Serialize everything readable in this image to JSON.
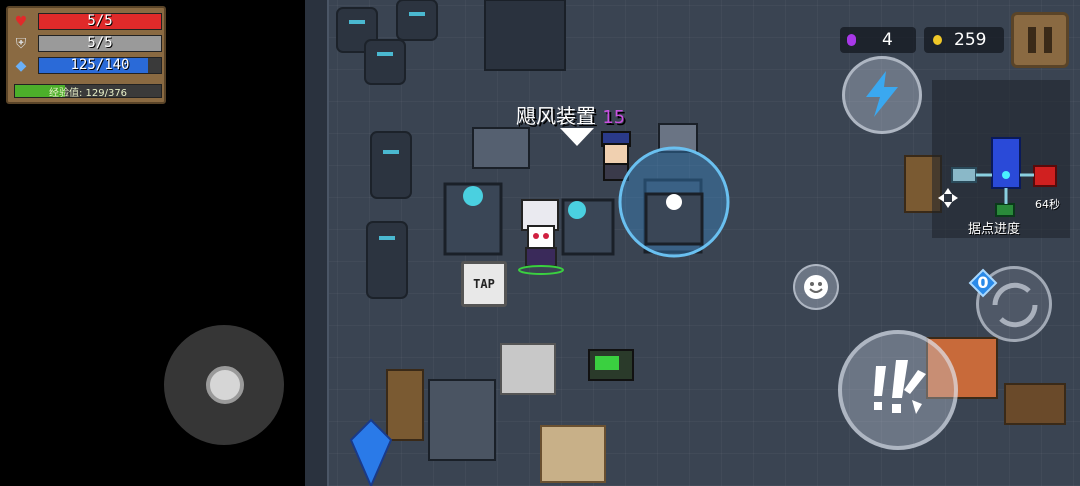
{
  "status": {
    "hp": {
      "current_max": "5/5",
      "fill": 1.0,
      "color": "#e02a2a",
      "icon": "heart-icon"
    },
    "armor": {
      "current_max": "5/5",
      "fill": 1.0,
      "color": "#9a9a9a",
      "icon": "shield-icon"
    },
    "energy": {
      "current_max": "125/140",
      "fill": 0.89,
      "color": "#2a6ad8",
      "icon": "energy-gem-icon"
    },
    "xp": {
      "label": "经验值: 129/376",
      "fill": 0.34,
      "color": "#4caf2a"
    }
  },
  "currency": {
    "gems": "4",
    "coins": "259",
    "gem_color": "#a838e8",
    "coin_color": "#f0c828"
  },
  "device": {
    "name": "飓风装置",
    "count": "15"
  },
  "tap_button": {
    "label": "TAP"
  },
  "minimap": {
    "progress_label": "据点进度",
    "timer": "64秒"
  },
  "buttons": {
    "pause_icon": "pause-icon",
    "skill_icon": "lightning-icon",
    "emote_icon": "smiley-icon",
    "attack_icon": "attack-burst-icon",
    "swap_counter": "0"
  }
}
